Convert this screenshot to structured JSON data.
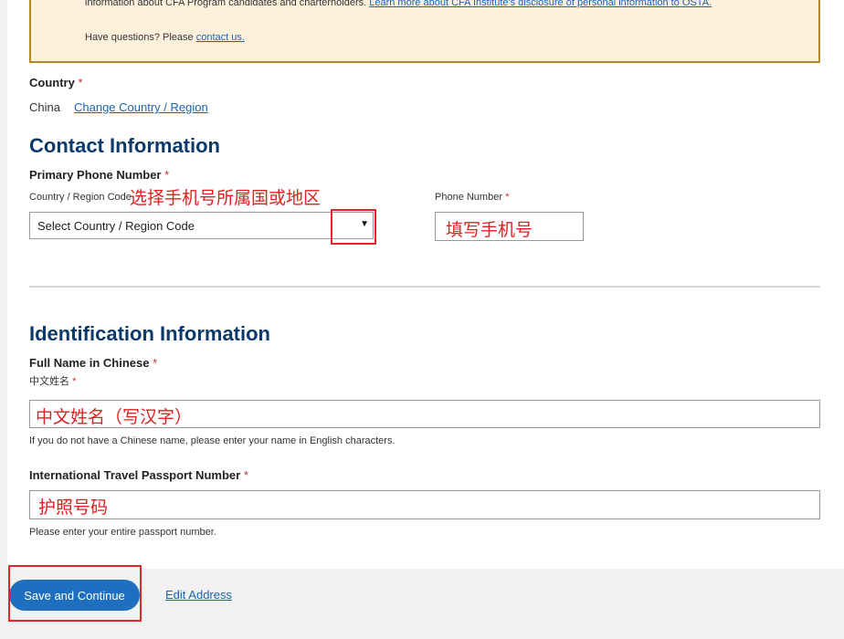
{
  "notice": {
    "line1_text": "information about CFA Program candidates and charterholders.",
    "line1_link": "Learn more about CFA Institute's disclosure of personal information to OSTA.",
    "questions_text": "Have questions? Please",
    "questions_link": "contact us."
  },
  "country": {
    "label": "Country",
    "required_mark": "*",
    "value": "China",
    "change_link": "Change Country / Region"
  },
  "contact": {
    "heading": "Contact Information",
    "primary_phone_label": "Primary Phone Number",
    "region_code_label": "Country / Region Code",
    "region_code_select_value": "Select Country / Region Code",
    "select_arrow": "▼",
    "phone_number_label": "Phone Number",
    "annotation_region": "选择手机号所属国或地区",
    "annotation_phone": "填写手机号"
  },
  "identification": {
    "heading": "Identification Information",
    "chinese_name_label": "Full Name in Chinese",
    "chinese_name_sublabel": "中文姓名",
    "chinese_name_value": "中文姓名（写汉字）",
    "chinese_name_help": "If you do not have a Chinese name, please enter your name in English characters.",
    "passport_label": "International Travel Passport Number",
    "passport_value": "护照号码",
    "passport_help": "Please enter your entire passport number."
  },
  "actions": {
    "save_label": "Save and Continue",
    "edit_address_label": "Edit Address"
  },
  "colors": {
    "heading": "#0c3a6b",
    "link": "#1a63b0",
    "primary_button": "#1f6fc0",
    "annotation": "#e0262b",
    "notice_bg": "#fdf1dc",
    "notice_border": "#b5892a"
  }
}
